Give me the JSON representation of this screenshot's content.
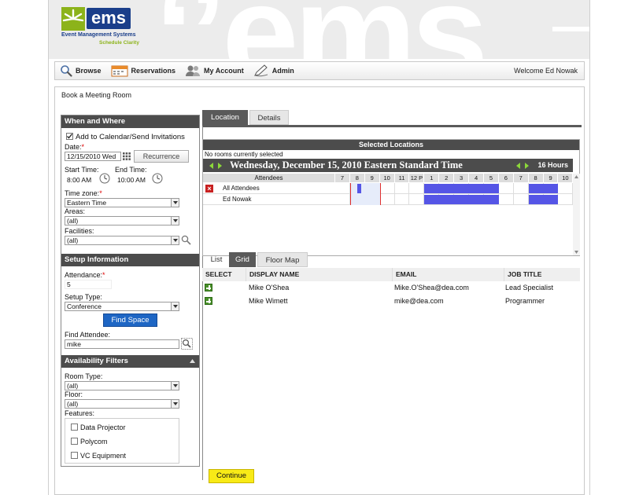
{
  "logo": {
    "brand": "ems",
    "tagline": "Event Management Systems",
    "subtitle": "Schedule Clarity"
  },
  "nav": {
    "items": [
      {
        "label": "Browse",
        "icon": "magnifier-icon"
      },
      {
        "label": "Reservations",
        "icon": "calendar-icon"
      },
      {
        "label": "My Account",
        "icon": "people-icon"
      },
      {
        "label": "Admin",
        "icon": "pen-icon"
      }
    ],
    "welcome": "Welcome Ed Nowak"
  },
  "page": {
    "title": "Book a Meeting Room"
  },
  "when_where": {
    "header": "When and Where",
    "add_to_calendar": "Add to Calendar/Send Invitations",
    "add_to_calendar_checked": true,
    "date_label": "Date:",
    "date_value": "12/15/2010 Wed",
    "recurrence_label": "Recurrence",
    "start_time_label": "Start Time:",
    "start_time_value": "8:00 AM",
    "end_time_label": "End Time:",
    "end_time_value": "10:00 AM",
    "timezone_label": "Time zone:",
    "timezone_value": "Eastern Time",
    "areas_label": "Areas:",
    "areas_value": "(all)",
    "facilities_label": "Facilities:",
    "facilities_value": "(all)"
  },
  "setup": {
    "header": "Setup Information",
    "attendance_label": "Attendance:",
    "attendance_value": "5",
    "setup_type_label": "Setup Type:",
    "setup_type_value": "Conference",
    "find_space_label": "Find Space",
    "find_attendee_label": "Find Attendee:",
    "find_attendee_value": "mike"
  },
  "availability": {
    "header": "Availability Filters",
    "room_type_label": "Room Type:",
    "room_type_value": "(all)",
    "floor_label": "Floor:",
    "floor_value": "(all)",
    "features_label": "Features:",
    "features": [
      {
        "label": "Data Projector",
        "checked": false
      },
      {
        "label": "Polycom",
        "checked": false
      },
      {
        "label": "VC Equipment",
        "checked": false
      }
    ]
  },
  "tabs": {
    "location": "Location",
    "details": "Details",
    "active": "location"
  },
  "selected_locations": {
    "header": "Selected Locations",
    "no_rooms": "No rooms currently selected",
    "date_title": "Wednesday, December 15, 2010 Eastern Standard Time",
    "hours_span": "16 Hours",
    "attendees_header": "Attendees",
    "hour_labels": [
      "7",
      "8",
      "9",
      "10",
      "11",
      "12 P",
      "1",
      "2",
      "3",
      "4",
      "5",
      "6",
      "7",
      "8",
      "9",
      "10"
    ],
    "attendees": [
      {
        "name": "All Attendees",
        "busy_hours": [
          [
            8.5,
            8.75
          ],
          [
            13,
            18
          ],
          [
            20,
            22
          ]
        ],
        "removable": true
      },
      {
        "name": "Ed Nowak",
        "busy_hours": [
          [
            13,
            18
          ],
          [
            20,
            22
          ]
        ],
        "removable": false
      }
    ],
    "selected_range": [
      8,
      10
    ]
  },
  "results_tabs": {
    "list": "List",
    "grid": "Grid",
    "floor_map": "Floor Map",
    "active": "grid"
  },
  "results": {
    "columns": [
      "SELECT",
      "DISPLAY NAME",
      "EMAIL",
      "JOB TITLE"
    ],
    "rows": [
      {
        "display_name": "Mike O'Shea",
        "email": "Mike.O'Shea@dea.com",
        "job_title": "Lead Specialist"
      },
      {
        "display_name": "Mike Wimett",
        "email": "mike@dea.com",
        "job_title": "Programmer"
      }
    ]
  },
  "continue_label": "Continue",
  "colors": {
    "busy": "#5555e6",
    "header_dark": "#4c4c4c",
    "continue_bg": "#f8ea17",
    "find_space_bg": "#1e66c4",
    "selected_range": "#e6ecfa",
    "now_line": "#e03030",
    "brand_navy": "#1a3e8a",
    "brand_green": "#8cb31a"
  }
}
